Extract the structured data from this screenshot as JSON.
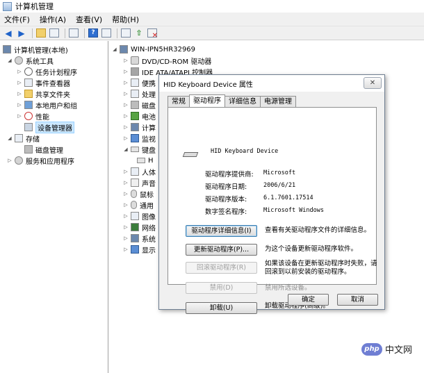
{
  "window": {
    "title": "计算机管理"
  },
  "menu": [
    "文件(F)",
    "操作(A)",
    "查看(V)",
    "帮助(H)"
  ],
  "left_tree": {
    "root": "计算机管理(本地)",
    "system_tools": "系统工具",
    "task_scheduler": "任务计划程序",
    "event_viewer": "事件查看器",
    "shared_folders": "共享文件夹",
    "local_users": "本地用户和组",
    "performance": "性能",
    "device_manager": "设备管理器",
    "storage": "存储",
    "disk_management": "磁盘管理",
    "services": "服务和应用程序"
  },
  "device_tree": {
    "computer_name": "WIN-IPN5HR32969",
    "items": [
      "DVD/CD-ROM 驱动器",
      "IDE ATA/ATAPI 控制器",
      "便携",
      "处理",
      "磁盘",
      "电池",
      "计算",
      "监视",
      "键盘",
      "H",
      "人体",
      "声音",
      "鼠标",
      "通用",
      "图像",
      "网络",
      "系统",
      "显示"
    ]
  },
  "dialog": {
    "title": "HID Keyboard Device 属性",
    "close": "✕",
    "tabs": [
      "常规",
      "驱动程序",
      "详细信息",
      "电源管理"
    ],
    "device_name": "HID Keyboard Device",
    "props": [
      {
        "label": "驱动程序提供商:",
        "value": "Microsoft"
      },
      {
        "label": "驱动程序日期:",
        "value": "2006/6/21"
      },
      {
        "label": "驱动程序版本:",
        "value": "6.1.7601.17514"
      },
      {
        "label": "数字签名程序:",
        "value": "Microsoft Windows"
      }
    ],
    "actions": [
      {
        "button": "驱动程序详细信息(I)",
        "desc": "查看有关驱动程序文件的详细信息。"
      },
      {
        "button": "更新驱动程序(P)...",
        "desc": "为这个设备更新驱动程序软件。"
      },
      {
        "button": "回滚驱动程序(R)",
        "desc": "如果该设备在更新驱动程序时失败，请回滚到以前安装的驱动程序。"
      },
      {
        "button": "禁用(D)",
        "desc": "禁用所选设备。"
      },
      {
        "button": "卸载(U)",
        "desc": "卸载驱动程序(高级)。"
      }
    ],
    "ok": "确定",
    "cancel": "取消"
  },
  "watermark": {
    "badge": "php",
    "text": "中文网"
  }
}
